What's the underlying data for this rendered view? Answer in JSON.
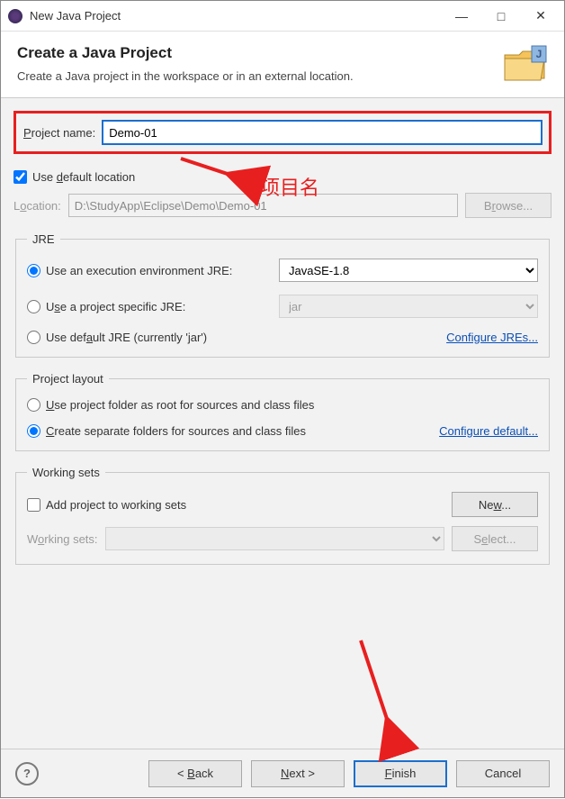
{
  "window": {
    "title": "New Java Project"
  },
  "header": {
    "title": "Create a Java Project",
    "subtitle": "Create a Java project in the workspace or in an external location."
  },
  "projectName": {
    "label_pre": "P",
    "label_post": "roject name:",
    "value": "Demo-01"
  },
  "location": {
    "useDefaultLabel_pre": "Use ",
    "useDefaultLabel_key": "d",
    "useDefaultLabel_post": "efault location",
    "useDefaultChecked": true,
    "locationLabel_pre": "L",
    "locationLabel_key": "o",
    "locationLabel_post": "cation:",
    "locationValue": "D:\\StudyApp\\Eclipse\\Demo\\Demo-01",
    "browseLabel_pre": "B",
    "browseLabel_key": "r",
    "browseLabel_post": "owse..."
  },
  "jre": {
    "legend": "JRE",
    "opt1_label": "Use an execution environment JRE:",
    "opt1_value": "JavaSE-1.8",
    "opt2_label_pre": "U",
    "opt2_label_key": "s",
    "opt2_label_post": "e a project specific JRE:",
    "opt2_value": "jar",
    "opt3_label_pre": "Use def",
    "opt3_label_key": "a",
    "opt3_label_post": "ult JRE (currently 'jar')",
    "configureLink": "Configure JREs..."
  },
  "layout": {
    "legend": "Project layout",
    "opt1_pre": "",
    "opt1_key": "U",
    "opt1_post": "se project folder as root for sources and class files",
    "opt2_pre": "",
    "opt2_key": "C",
    "opt2_post": "reate separate folders for sources and class files",
    "configureLink": "Configure default..."
  },
  "workingSets": {
    "legend": "Working sets",
    "addLabel": "Add project to working sets",
    "newLabel_pre": "Ne",
    "newLabel_key": "w",
    "newLabel_post": "...",
    "wsLabel_pre": "W",
    "wsLabel_key": "o",
    "wsLabel_post": "rking sets:",
    "selectLabel_pre": "S",
    "selectLabel_key": "e",
    "selectLabel_post": "lect..."
  },
  "buttons": {
    "back_pre": "< ",
    "back_key": "B",
    "back_post": "ack",
    "next_pre": "",
    "next_key": "N",
    "next_post": "ext >",
    "finish_pre": "",
    "finish_key": "F",
    "finish_post": "inish",
    "cancel": "Cancel",
    "help": "?"
  },
  "annotation": {
    "label": "项目名"
  }
}
